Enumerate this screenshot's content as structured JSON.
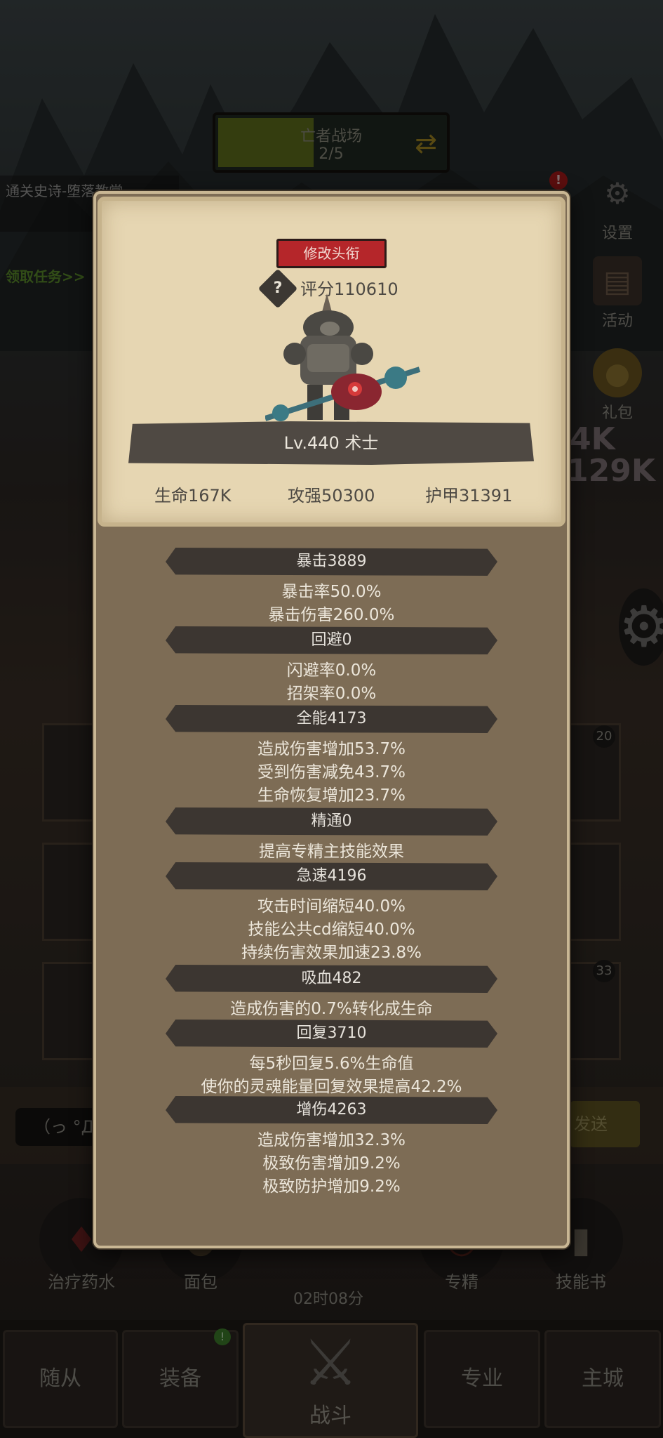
{
  "stage": {
    "name": "亡者战场",
    "progress": "2/5"
  },
  "quest": {
    "title": "通关史诗-堕落教堂",
    "link": "领取任务>>"
  },
  "side_buttons": [
    {
      "label": "设置",
      "icon": "gear-icon"
    },
    {
      "label": "活动",
      "icon": "scroll-icon"
    },
    {
      "label": "礼包",
      "icon": "treasure-icon"
    }
  ],
  "bg_numbers": {
    "a": "4K",
    "b": "129K"
  },
  "slot_badges": [
    "20",
    "33"
  ],
  "chat": {
    "input": "（っ °Д",
    "send": "发送"
  },
  "items": [
    {
      "label": "治疗药水",
      "icon": "potion-icon"
    },
    {
      "label": "面包",
      "icon": "bread-icon"
    },
    {
      "label": "专精",
      "icon": "talent-icon"
    },
    {
      "label": "技能书",
      "icon": "book-icon"
    }
  ],
  "timer": "02时08分",
  "nav": {
    "follower": "随从",
    "equip": "装备",
    "fight": "战斗",
    "profession": "专业",
    "city": "主城"
  },
  "badges": {
    "alert": "!",
    "equip": "!"
  },
  "profile": {
    "title_button": "修改头衔",
    "score": "评分110610",
    "level_class": "Lv.440 术士",
    "stats": [
      "生命167K",
      "攻强50300",
      "护甲31391"
    ]
  },
  "attributes": [
    {
      "header": "暴击3889",
      "lines": [
        "暴击率50.0%",
        "暴击伤害260.0%"
      ]
    },
    {
      "header": "回避0",
      "lines": [
        "闪避率0.0%",
        "招架率0.0%"
      ]
    },
    {
      "header": "全能4173",
      "lines": [
        "造成伤害增加53.7%",
        "受到伤害减免43.7%",
        "生命恢复增加23.7%"
      ]
    },
    {
      "header": "精通0",
      "lines": [
        "提高专精主技能效果"
      ]
    },
    {
      "header": "急速4196",
      "lines": [
        "攻击时间缩短40.0%",
        "技能公共cd缩短40.0%",
        "持续伤害效果加速23.8%"
      ]
    },
    {
      "header": "吸血482",
      "lines": [
        "造成伤害的0.7%转化成生命"
      ]
    },
    {
      "header": "回复3710",
      "lines": [
        "每5秒回复5.6%生命值",
        "使你的灵魂能量回复效果提高42.2%"
      ]
    },
    {
      "header": "增伤4263",
      "lines": [
        "造成伤害增加32.3%",
        "极致伤害增加9.2%",
        "极致防护增加9.2%"
      ]
    }
  ]
}
